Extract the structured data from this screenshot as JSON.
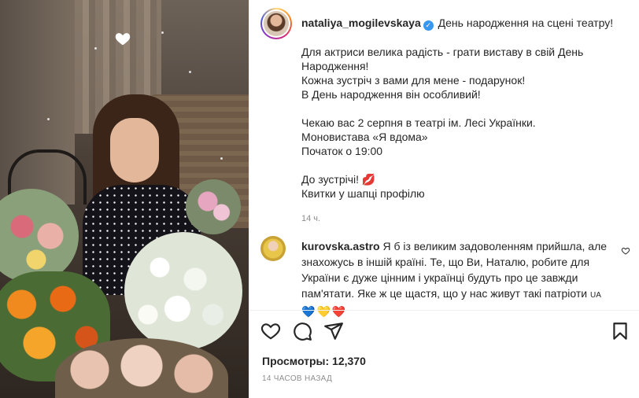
{
  "post": {
    "username": "nataliya_mogilevskaya",
    "caption_lines": [
      "День народження на сцені театру!",
      "",
      "Для актриси велика радість - грати виставу в свій День Народження!",
      "Кожна зустріч з вами для мене - подарунок!",
      "В День народження він особливий!",
      "",
      "Чекаю вас 2 серпня в театрі ім. Лесі Українки.",
      "Моновистава «Я вдома»",
      "Початок о 19:00",
      "",
      "До зустрічі!",
      "Квитки у шапці профілю"
    ],
    "kiss_emoji": "💋",
    "time": "14 ч."
  },
  "comment": {
    "username": "kurovska.astro",
    "text": "Я б із великим задоволенням прийшла, але знахожусь в іншій країні. Те, що Ви, Наталю, робите для України є дуже цінним і українці будуть про це завжди пам'ятати. Яке ж це щастя, що у нас живут такі патріоти",
    "tag": "UA",
    "hearts": [
      "💙",
      "💛",
      "❤️"
    ]
  },
  "stats": {
    "views": "Просмотры: 12,370",
    "time_ago": "14 ЧАСОВ НАЗАД"
  },
  "icons": {
    "like": "heart-outline-icon",
    "comment": "speech-bubble-icon",
    "share": "paper-plane-icon",
    "save": "bookmark-icon",
    "verified": "verified-badge-icon",
    "media_heart": "heart-filled-icon"
  },
  "colors": {
    "verified": "#3897f0",
    "text": "#262626",
    "muted": "#8e8e8e"
  }
}
